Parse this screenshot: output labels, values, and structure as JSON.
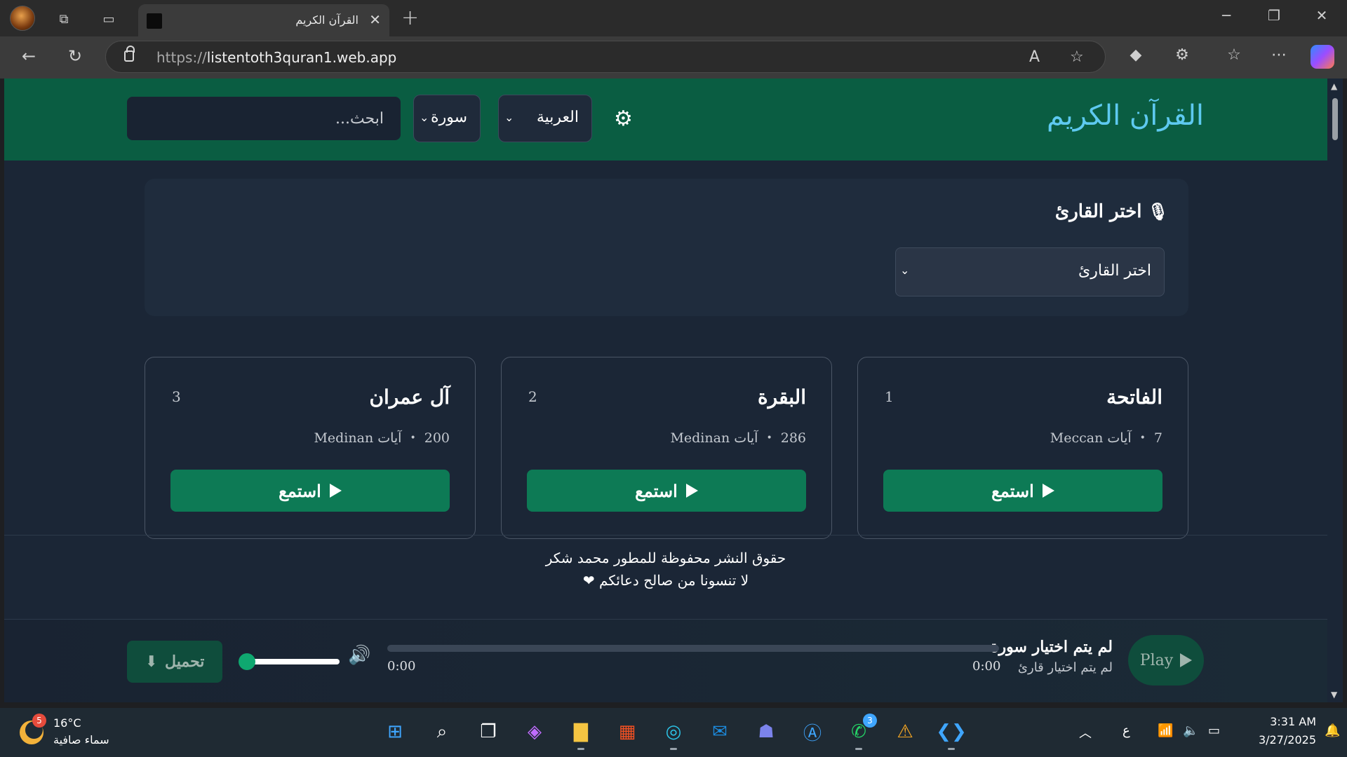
{
  "browser": {
    "tab_title": "القرآن الكريم",
    "url_scheme": "https://",
    "url_host": "listentoth3quran1.web.app"
  },
  "header": {
    "brand": "القرآن الكريم",
    "language_selected": "العربية",
    "search_by_selected": "سورة",
    "search_placeholder": "ابحث..."
  },
  "reciter": {
    "title": "اختر القارئ",
    "select_placeholder": "اختر القارئ"
  },
  "surahs": [
    {
      "name": "الفاتحة",
      "number": "1",
      "ayahs": "7",
      "type": "Meccan آيات",
      "listen": "استمع"
    },
    {
      "name": "البقرة",
      "number": "2",
      "ayahs": "286",
      "type": "Medinan آيات",
      "listen": "استمع"
    },
    {
      "name": "آل عمران",
      "number": "3",
      "ayahs": "200",
      "type": "Medinan آيات",
      "listen": "استمع"
    }
  ],
  "footer": {
    "line1": "حقوق النشر محفوظة للمطور محمد شكر",
    "line2": "لا تنسونا من صالح دعائكم ❤"
  },
  "player": {
    "play_label": "Play",
    "now_playing_title": "لم يتم اختيار سورة",
    "now_playing_sub": "لم يتم اختيار قارئ",
    "current_time": "0:00",
    "duration": "0:00",
    "progress": 0,
    "volume": 0,
    "download_label": "تحميل"
  },
  "taskbar": {
    "weather_badge": "5",
    "temperature": "16°C",
    "weather_desc": "سماء صافية",
    "whatsapp_badge": "3",
    "keyboard_lang": "ع",
    "time": "3:31 AM",
    "date": "3/27/2025"
  },
  "colors": {
    "header_bg": "#0a5d42",
    "page_bg": "#1b2636",
    "accent_green": "#0d7a55",
    "brand_text": "#5ec9f0"
  }
}
